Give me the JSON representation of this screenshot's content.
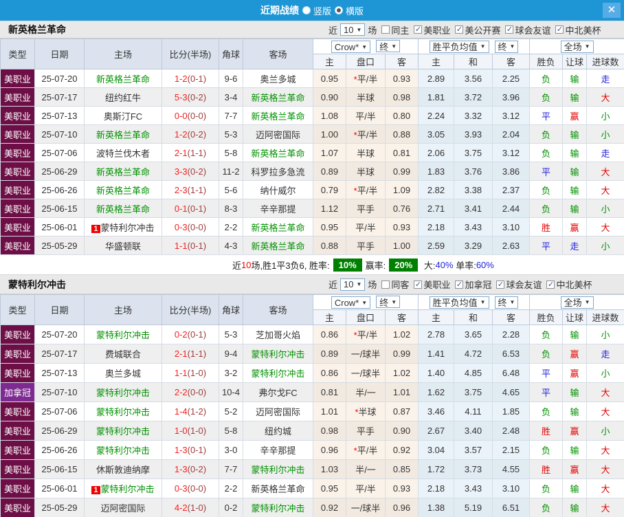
{
  "titlebar": {
    "title": "近期战绩",
    "radio_options": [
      {
        "label": "竖版",
        "checked": false
      },
      {
        "label": "横版",
        "checked": true
      }
    ]
  },
  "colors": {
    "topbar": "#1E96D6",
    "league_mls": "#6D0E46",
    "league_can": "#7D2B90",
    "team_green": "#009000",
    "score_red": "#FF1A1A",
    "half_red": "#A03C3C",
    "result_red": "#E60000",
    "result_green": "#009000",
    "result_blue": "#2020DD",
    "badge_green": "#008000"
  },
  "table_header": {
    "type": "类型",
    "date": "日期",
    "home": "主场",
    "score": "比分(半场)",
    "corner": "角球",
    "away": "客场",
    "group1_select": "Crow*",
    "group1_final": "终",
    "group2_select": "胜平负均值",
    "group2_final": "终",
    "group3_select": "全场",
    "sub": [
      "主",
      "盘口",
      "客",
      "主",
      "和",
      "客",
      "胜负",
      "让球",
      "进球数"
    ]
  },
  "filter_labels": {
    "near": "近",
    "games": "10",
    "matches": "场"
  },
  "sections": [
    {
      "team": "新英格兰革命",
      "same_label": "同主",
      "same_checked": false,
      "leagues": [
        "美职业",
        "美公开赛",
        "球会友谊",
        "中北美杯"
      ],
      "rows": [
        {
          "league": "美职业",
          "lc": "mls",
          "date": "25-07-20",
          "home": "新英格兰革命",
          "home_green": true,
          "home_badge": "",
          "score": "1-2",
          "half": "(0-1)",
          "corner": "9-6",
          "away": "奥兰多城",
          "away_green": false,
          "w1": "0.95",
          "star": true,
          "handicap": "平/半",
          "w2": "0.93",
          "a1": "2.89",
          "a2": "3.56",
          "a3": "2.25",
          "r1": "负",
          "r1c": "g",
          "r2": "输",
          "r2c": "g",
          "r3": "走",
          "r3c": "b"
        },
        {
          "league": "美职业",
          "lc": "mls",
          "date": "25-07-17",
          "home": "纽约红牛",
          "home_green": false,
          "home_badge": "",
          "score": "5-3",
          "half": "(0-2)",
          "corner": "3-4",
          "away": "新英格兰革命",
          "away_green": true,
          "w1": "0.90",
          "star": false,
          "handicap": "半球",
          "w2": "0.98",
          "a1": "1.81",
          "a2": "3.72",
          "a3": "3.96",
          "r1": "负",
          "r1c": "g",
          "r2": "输",
          "r2c": "g",
          "r3": "大",
          "r3c": "r"
        },
        {
          "league": "美职业",
          "lc": "mls",
          "date": "25-07-13",
          "home": "奥斯汀FC",
          "home_green": false,
          "home_badge": "",
          "score": "0-0",
          "half": "(0-0)",
          "corner": "7-7",
          "away": "新英格兰革命",
          "away_green": true,
          "w1": "1.08",
          "star": false,
          "handicap": "平/半",
          "w2": "0.80",
          "a1": "2.24",
          "a2": "3.32",
          "a3": "3.12",
          "r1": "平",
          "r1c": "b",
          "r2": "赢",
          "r2c": "r",
          "r3": "小",
          "r3c": "g"
        },
        {
          "league": "美职业",
          "lc": "mls",
          "date": "25-07-10",
          "home": "新英格兰革命",
          "home_green": true,
          "home_badge": "",
          "score": "1-2",
          "half": "(0-2)",
          "corner": "5-3",
          "away": "迈阿密国际",
          "away_green": false,
          "w1": "1.00",
          "star": true,
          "handicap": "平/半",
          "w2": "0.88",
          "a1": "3.05",
          "a2": "3.93",
          "a3": "2.04",
          "r1": "负",
          "r1c": "g",
          "r2": "输",
          "r2c": "g",
          "r3": "小",
          "r3c": "g"
        },
        {
          "league": "美职业",
          "lc": "mls",
          "date": "25-07-06",
          "home": "波特兰伐木者",
          "home_green": false,
          "home_badge": "",
          "score": "2-1",
          "half": "(1-1)",
          "corner": "5-8",
          "away": "新英格兰革命",
          "away_green": true,
          "w1": "1.07",
          "star": false,
          "handicap": "半球",
          "w2": "0.81",
          "a1": "2.06",
          "a2": "3.75",
          "a3": "3.12",
          "r1": "负",
          "r1c": "g",
          "r2": "输",
          "r2c": "g",
          "r3": "走",
          "r3c": "b"
        },
        {
          "league": "美职业",
          "lc": "mls",
          "date": "25-06-29",
          "home": "新英格兰革命",
          "home_green": true,
          "home_badge": "",
          "score": "3-3",
          "half": "(0-2)",
          "corner": "11-2",
          "away": "科罗拉多急流",
          "away_green": false,
          "w1": "0.89",
          "star": false,
          "handicap": "半球",
          "w2": "0.99",
          "a1": "1.83",
          "a2": "3.76",
          "a3": "3.86",
          "r1": "平",
          "r1c": "b",
          "r2": "输",
          "r2c": "g",
          "r3": "大",
          "r3c": "r"
        },
        {
          "league": "美职业",
          "lc": "mls",
          "date": "25-06-26",
          "home": "新英格兰革命",
          "home_green": true,
          "home_badge": "",
          "score": "2-3",
          "half": "(1-1)",
          "corner": "5-6",
          "away": "纳什威尔",
          "away_green": false,
          "w1": "0.79",
          "star": true,
          "handicap": "平/半",
          "w2": "1.09",
          "a1": "2.82",
          "a2": "3.38",
          "a3": "2.37",
          "r1": "负",
          "r1c": "g",
          "r2": "输",
          "r2c": "g",
          "r3": "大",
          "r3c": "r"
        },
        {
          "league": "美职业",
          "lc": "mls",
          "date": "25-06-15",
          "home": "新英格兰革命",
          "home_green": true,
          "home_badge": "",
          "score": "0-1",
          "half": "(0-1)",
          "corner": "8-3",
          "away": "辛辛那提",
          "away_green": false,
          "w1": "1.12",
          "star": false,
          "handicap": "平手",
          "w2": "0.76",
          "a1": "2.71",
          "a2": "3.41",
          "a3": "2.44",
          "r1": "负",
          "r1c": "g",
          "r2": "输",
          "r2c": "g",
          "r3": "小",
          "r3c": "g"
        },
        {
          "league": "美职业",
          "lc": "mls",
          "date": "25-06-01",
          "home": "蒙特利尔冲击",
          "home_green": false,
          "home_badge": "1",
          "score": "0-3",
          "half": "(0-0)",
          "corner": "2-2",
          "away": "新英格兰革命",
          "away_green": true,
          "w1": "0.95",
          "star": false,
          "handicap": "平/半",
          "w2": "0.93",
          "a1": "2.18",
          "a2": "3.43",
          "a3": "3.10",
          "r1": "胜",
          "r1c": "r",
          "r2": "赢",
          "r2c": "r",
          "r3": "大",
          "r3c": "r"
        },
        {
          "league": "美职业",
          "lc": "mls",
          "date": "25-05-29",
          "home": "华盛顿联",
          "home_green": false,
          "home_badge": "",
          "score": "1-1",
          "half": "(0-1)",
          "corner": "4-3",
          "away": "新英格兰革命",
          "away_green": true,
          "w1": "0.88",
          "star": false,
          "handicap": "平手",
          "w2": "1.00",
          "a1": "2.59",
          "a2": "3.29",
          "a3": "2.63",
          "r1": "平",
          "r1c": "b",
          "r2": "走",
          "r2c": "b",
          "r3": "小",
          "r3c": "g"
        }
      ],
      "summary": {
        "prefix": "近",
        "count": "10",
        "mid": "场,胜1平3负6, 胜率:",
        "win_rate": "10%",
        "label2": "赢率:",
        "win_rate2": "20%",
        "big_label": "大:",
        "big_value": "40%",
        "single_label": "单率:",
        "single_value": "60%"
      }
    },
    {
      "team": "蒙特利尔冲击",
      "same_label": "同客",
      "same_checked": false,
      "leagues": [
        "美职业",
        "加拿冠",
        "球会友谊",
        "中北美杯"
      ],
      "rows": [
        {
          "league": "美职业",
          "lc": "mls",
          "date": "25-07-20",
          "home": "蒙特利尔冲击",
          "home_green": true,
          "home_badge": "",
          "score": "0-2",
          "half": "(0-1)",
          "corner": "5-3",
          "away": "芝加哥火焰",
          "away_green": false,
          "w1": "0.86",
          "star": true,
          "handicap": "平/半",
          "w2": "1.02",
          "a1": "2.78",
          "a2": "3.65",
          "a3": "2.28",
          "r1": "负",
          "r1c": "g",
          "r2": "输",
          "r2c": "g",
          "r3": "小",
          "r3c": "g"
        },
        {
          "league": "美职业",
          "lc": "mls",
          "date": "25-07-17",
          "home": "费城联合",
          "home_green": false,
          "home_badge": "",
          "score": "2-1",
          "half": "(1-1)",
          "corner": "9-4",
          "away": "蒙特利尔冲击",
          "away_green": true,
          "w1": "0.89",
          "star": false,
          "handicap": "一/球半",
          "w2": "0.99",
          "a1": "1.41",
          "a2": "4.72",
          "a3": "6.53",
          "r1": "负",
          "r1c": "g",
          "r2": "赢",
          "r2c": "r",
          "r3": "走",
          "r3c": "b"
        },
        {
          "league": "美职业",
          "lc": "mls",
          "date": "25-07-13",
          "home": "奥兰多城",
          "home_green": false,
          "home_badge": "",
          "score": "1-1",
          "half": "(1-0)",
          "corner": "3-2",
          "away": "蒙特利尔冲击",
          "away_green": true,
          "w1": "0.86",
          "star": false,
          "handicap": "一/球半",
          "w2": "1.02",
          "a1": "1.40",
          "a2": "4.85",
          "a3": "6.48",
          "r1": "平",
          "r1c": "b",
          "r2": "赢",
          "r2c": "r",
          "r3": "小",
          "r3c": "g"
        },
        {
          "league": "加拿冠",
          "lc": "can",
          "date": "25-07-10",
          "home": "蒙特利尔冲击",
          "home_green": true,
          "home_badge": "",
          "score": "2-2",
          "half": "(0-0)",
          "corner": "10-4",
          "away": "弗尔戈FC",
          "away_green": false,
          "w1": "0.81",
          "star": false,
          "handicap": "半/一",
          "w2": "1.01",
          "a1": "1.62",
          "a2": "3.75",
          "a3": "4.65",
          "r1": "平",
          "r1c": "b",
          "r2": "输",
          "r2c": "g",
          "r3": "大",
          "r3c": "r"
        },
        {
          "league": "美职业",
          "lc": "mls",
          "date": "25-07-06",
          "home": "蒙特利尔冲击",
          "home_green": true,
          "home_badge": "",
          "score": "1-4",
          "half": "(1-2)",
          "corner": "5-2",
          "away": "迈阿密国际",
          "away_green": false,
          "w1": "1.01",
          "star": true,
          "handicap": "半球",
          "w2": "0.87",
          "a1": "3.46",
          "a2": "4.11",
          "a3": "1.85",
          "r1": "负",
          "r1c": "g",
          "r2": "输",
          "r2c": "g",
          "r3": "大",
          "r3c": "r"
        },
        {
          "league": "美职业",
          "lc": "mls",
          "date": "25-06-29",
          "home": "蒙特利尔冲击",
          "home_green": true,
          "home_badge": "",
          "score": "1-0",
          "half": "(1-0)",
          "corner": "5-8",
          "away": "纽约城",
          "away_green": false,
          "w1": "0.98",
          "star": false,
          "handicap": "平手",
          "w2": "0.90",
          "a1": "2.67",
          "a2": "3.40",
          "a3": "2.48",
          "r1": "胜",
          "r1c": "r",
          "r2": "赢",
          "r2c": "r",
          "r3": "小",
          "r3c": "g"
        },
        {
          "league": "美职业",
          "lc": "mls",
          "date": "25-06-26",
          "home": "蒙特利尔冲击",
          "home_green": true,
          "home_badge": "",
          "score": "1-3",
          "half": "(0-1)",
          "corner": "3-0",
          "away": "辛辛那提",
          "away_green": false,
          "w1": "0.96",
          "star": true,
          "handicap": "平/半",
          "w2": "0.92",
          "a1": "3.04",
          "a2": "3.57",
          "a3": "2.15",
          "r1": "负",
          "r1c": "g",
          "r2": "输",
          "r2c": "g",
          "r3": "大",
          "r3c": "r"
        },
        {
          "league": "美职业",
          "lc": "mls",
          "date": "25-06-15",
          "home": "休斯敦迪纳摩",
          "home_green": false,
          "home_badge": "",
          "score": "1-3",
          "half": "(0-2)",
          "corner": "7-7",
          "away": "蒙特利尔冲击",
          "away_green": true,
          "w1": "1.03",
          "star": false,
          "handicap": "半/一",
          "w2": "0.85",
          "a1": "1.72",
          "a2": "3.73",
          "a3": "4.55",
          "r1": "胜",
          "r1c": "r",
          "r2": "赢",
          "r2c": "r",
          "r3": "大",
          "r3c": "r"
        },
        {
          "league": "美职业",
          "lc": "mls",
          "date": "25-06-01",
          "home": "蒙特利尔冲击",
          "home_green": true,
          "home_badge": "1",
          "score": "0-3",
          "half": "(0-0)",
          "corner": "2-2",
          "away": "新英格兰革命",
          "away_green": false,
          "w1": "0.95",
          "star": false,
          "handicap": "平/半",
          "w2": "0.93",
          "a1": "2.18",
          "a2": "3.43",
          "a3": "3.10",
          "r1": "负",
          "r1c": "g",
          "r2": "输",
          "r2c": "g",
          "r3": "大",
          "r3c": "r"
        },
        {
          "league": "美职业",
          "lc": "mls",
          "date": "25-05-29",
          "home": "迈阿密国际",
          "home_green": false,
          "home_badge": "",
          "score": "4-2",
          "half": "(1-0)",
          "corner": "0-2",
          "away": "蒙特利尔冲击",
          "away_green": true,
          "w1": "0.92",
          "star": false,
          "handicap": "一/球半",
          "w2": "0.96",
          "a1": "1.38",
          "a2": "5.19",
          "a3": "6.51",
          "r1": "负",
          "r1c": "g",
          "r2": "输",
          "r2c": "g",
          "r3": "大",
          "r3c": "r"
        }
      ]
    }
  ]
}
